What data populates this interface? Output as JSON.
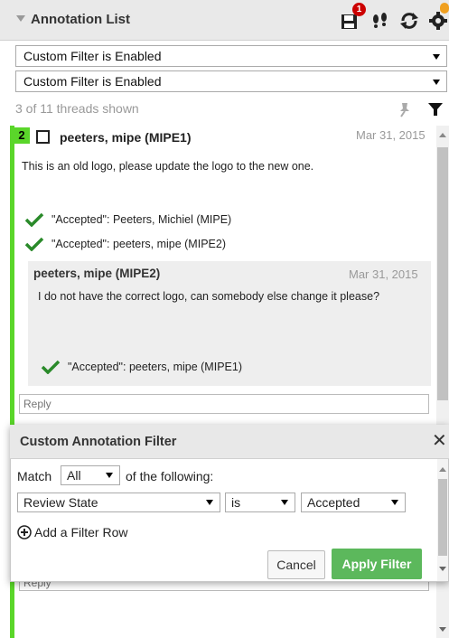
{
  "header": {
    "title": "Annotation List",
    "notification_badge": "1",
    "accent": "#cc0000"
  },
  "filters": {
    "filter1": "Custom Filter is Enabled",
    "filter2": "Custom Filter is Enabled"
  },
  "summary": {
    "count_text": "3 of 11 threads shown"
  },
  "thread": {
    "number": "2",
    "author": "peeters, mipe (MIPE1)",
    "date": "Mar 31, 2015",
    "body": "This is an old logo, please update the logo to the new one.",
    "accepted": [
      "\"Accepted\": Peeters, Michiel (MIPE)",
      "\"Accepted\": peeters, mipe (MIPE2)"
    ],
    "reply": {
      "author": "peeters, mipe (MIPE2)",
      "date": "Mar 31, 2015",
      "body": "I do not have the correct logo, can somebody else change it please?",
      "accepted": "\"Accepted\": peeters, mipe (MIPE1)"
    },
    "reply_placeholder": "Reply",
    "status_color": "#5ad62a"
  },
  "dialog": {
    "title": "Custom Annotation Filter",
    "close": "✕",
    "match_label": "Match",
    "match_value": "All",
    "match_suffix": "of the following:",
    "row": {
      "field": "Review State",
      "operator": "is",
      "value": "Accepted"
    },
    "add_row_label": "Add a Filter Row",
    "cancel_label": "Cancel",
    "apply_label": "Apply Filter",
    "apply_color": "#5cb85c"
  },
  "icons": {
    "save": "save-icon",
    "footsteps": "footsteps-icon",
    "refresh": "refresh-icon",
    "settings": "settings-icon",
    "pin": "pin-icon",
    "filter": "filter-icon",
    "check": "check-icon"
  }
}
